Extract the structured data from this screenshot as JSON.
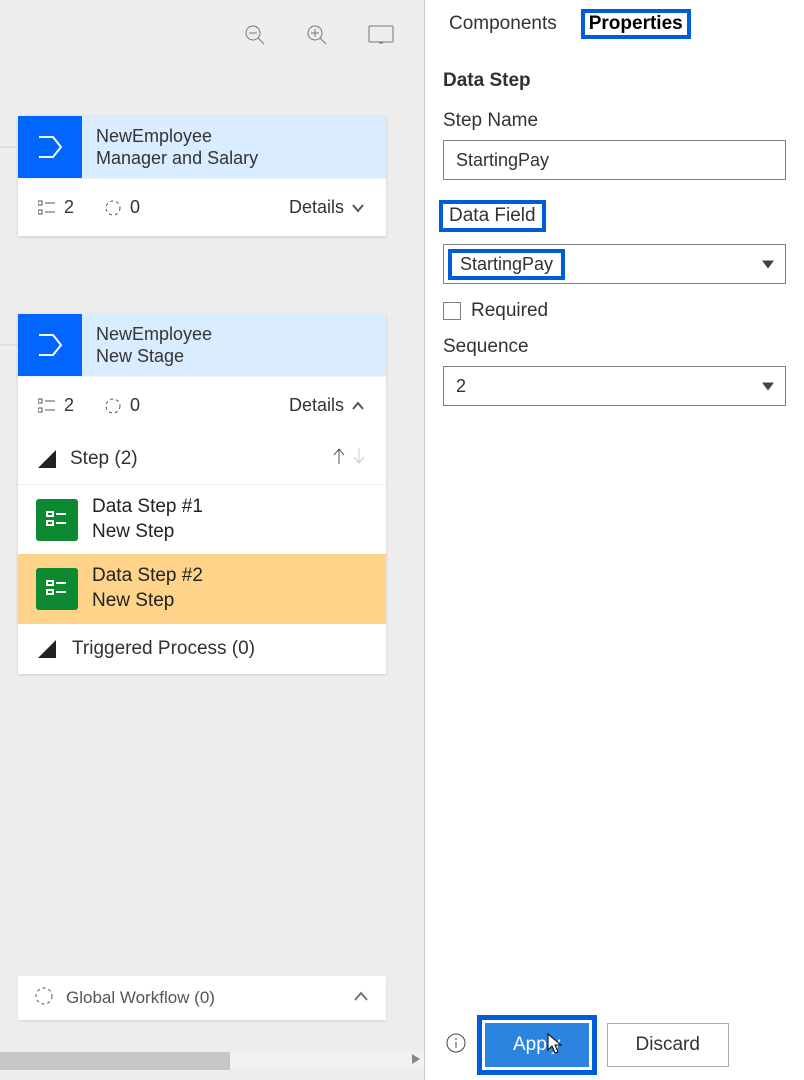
{
  "toolbar": {
    "zoom_out": "zoom-out",
    "zoom_in": "zoom-in",
    "fit": "fit-screen"
  },
  "stages": [
    {
      "entity": "NewEmployee",
      "name": "Manager and Salary",
      "step_count": "2",
      "trigger_count": "0",
      "details_label": "Details"
    },
    {
      "entity": "NewEmployee",
      "name": "New Stage",
      "step_count": "2",
      "trigger_count": "0",
      "details_label": "Details",
      "step_header": "Step (2)",
      "steps": [
        {
          "title": "Data Step #1",
          "subtitle": "New Step"
        },
        {
          "title": "Data Step #2",
          "subtitle": "New Step"
        }
      ],
      "triggered_label": "Triggered Process (0)"
    }
  ],
  "global_workflow": {
    "label": "Global Workflow (0)"
  },
  "tabs": {
    "components": "Components",
    "properties": "Properties"
  },
  "panel": {
    "title": "Data Step",
    "step_name_label": "Step Name",
    "step_name_value": "StartingPay",
    "data_field_label": "Data Field",
    "data_field_value": "StartingPay",
    "required_label": "Required",
    "sequence_label": "Sequence",
    "sequence_value": "2"
  },
  "footer": {
    "apply": "Apply",
    "discard": "Discard"
  }
}
